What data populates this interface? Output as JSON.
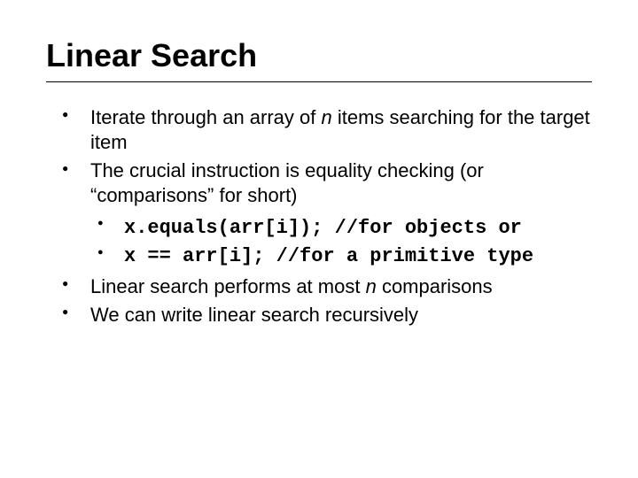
{
  "title": "Linear Search",
  "bullets": {
    "b1_pre": "Iterate through an array of ",
    "b1_n": "n",
    "b1_post": " items searching for the target item",
    "b2": "The crucial instruction is equality checking (or “comparisons” for short)",
    "sub1_code": "x.equals(arr[i]);",
    "sub1_comment": " //for objects or",
    "sub2_code": "x == arr[i];",
    "sub2_comment": " //for a primitive type",
    "b3_pre": "Linear search performs at most ",
    "b3_n": "n",
    "b3_post": " comparisons",
    "b4": "We can write linear search recursively"
  }
}
